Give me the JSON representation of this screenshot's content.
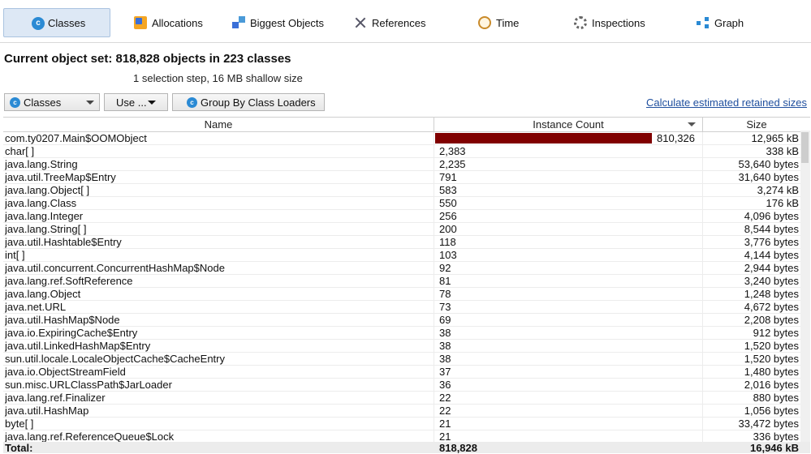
{
  "tabs": [
    {
      "label": "Classes",
      "icon": "classes-icon",
      "active": true
    },
    {
      "label": "Allocations",
      "icon": "allocations-icon"
    },
    {
      "label": "Biggest Objects",
      "icon": "biggest-objects-icon"
    },
    {
      "label": "References",
      "icon": "references-icon"
    },
    {
      "label": "Time",
      "icon": "time-icon"
    },
    {
      "label": "Inspections",
      "icon": "inspections-icon"
    },
    {
      "label": "Graph",
      "icon": "graph-icon"
    }
  ],
  "header": {
    "title": "Current object set:  818,828 objects in 223 classes",
    "subtitle": "1 selection step, 16 MB shallow size"
  },
  "toolbar": {
    "view_select": "Classes",
    "use_button": "Use ...",
    "group_button": "Group By Class Loaders",
    "retained_link": "Calculate estimated retained sizes"
  },
  "table": {
    "columns": [
      "Name",
      "Instance Count",
      "Size"
    ],
    "bar_color": "#800000",
    "rows": [
      {
        "name": "com.ty0207.Main$OOMObject",
        "count": "810,326",
        "count_value": 810326,
        "size": "12,965 kB"
      },
      {
        "name": "char[ ]",
        "count": "2,383",
        "size": "338 kB"
      },
      {
        "name": "java.lang.String",
        "count": "2,235",
        "size": "53,640 bytes"
      },
      {
        "name": "java.util.TreeMap$Entry",
        "count": "791",
        "size": "31,640 bytes"
      },
      {
        "name": "java.lang.Object[ ]",
        "count": "583",
        "size": "3,274 kB"
      },
      {
        "name": "java.lang.Class",
        "count": "550",
        "size": "176 kB"
      },
      {
        "name": "java.lang.Integer",
        "count": "256",
        "size": "4,096 bytes"
      },
      {
        "name": "java.lang.String[ ]",
        "count": "200",
        "size": "8,544 bytes"
      },
      {
        "name": "java.util.Hashtable$Entry",
        "count": "118",
        "size": "3,776 bytes"
      },
      {
        "name": "int[ ]",
        "count": "103",
        "size": "4,144 bytes"
      },
      {
        "name": "java.util.concurrent.ConcurrentHashMap$Node",
        "count": "92",
        "size": "2,944 bytes"
      },
      {
        "name": "java.lang.ref.SoftReference",
        "count": "81",
        "size": "3,240 bytes"
      },
      {
        "name": "java.lang.Object",
        "count": "78",
        "size": "1,248 bytes"
      },
      {
        "name": "java.net.URL",
        "count": "73",
        "size": "4,672 bytes"
      },
      {
        "name": "java.util.HashMap$Node",
        "count": "69",
        "size": "2,208 bytes"
      },
      {
        "name": "java.io.ExpiringCache$Entry",
        "count": "38",
        "size": "912 bytes"
      },
      {
        "name": "java.util.LinkedHashMap$Entry",
        "count": "38",
        "size": "1,520 bytes"
      },
      {
        "name": "sun.util.locale.LocaleObjectCache$CacheEntry",
        "count": "38",
        "size": "1,520 bytes"
      },
      {
        "name": "java.io.ObjectStreamField",
        "count": "37",
        "size": "1,480 bytes"
      },
      {
        "name": "sun.misc.URLClassPath$JarLoader",
        "count": "36",
        "size": "2,016 bytes"
      },
      {
        "name": "java.lang.ref.Finalizer",
        "count": "22",
        "size": "880 bytes"
      },
      {
        "name": "java.util.HashMap",
        "count": "22",
        "size": "1,056 bytes"
      },
      {
        "name": "byte[ ]",
        "count": "21",
        "size": "33,472 bytes"
      },
      {
        "name": "java.lang.ref.ReferenceQueue$Lock",
        "count": "21",
        "size": "336 bytes"
      }
    ],
    "total": {
      "label": "Total:",
      "count": "818,828",
      "size": "16,946 kB"
    }
  }
}
